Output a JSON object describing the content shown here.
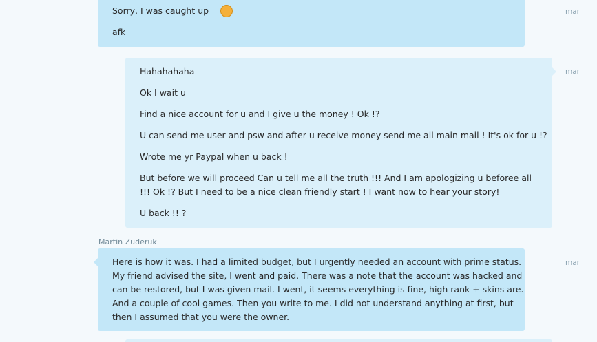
{
  "messages": [
    {
      "id": "msg-1",
      "direction": "incoming",
      "partial_line": "Sorry, I was caught up",
      "lines": [
        "afk"
      ],
      "time": "mar"
    },
    {
      "id": "msg-2",
      "direction": "outgoing",
      "lines": [
        "Hahahahaha",
        "Ok I wait u",
        "Find a nice account for u and I give u the money ! Ok !?",
        "U can send me user and psw and after u receive money send me all main mail ! It's ok for u !?",
        "Wrote me yr Paypal when u back !",
        "But before we will proceed Can u tell me all the truth !!! And I am apologizing u beforee all !!! Ok !? But I need to be a nice clean friendly start ! I want now to hear your story!",
        "U back !! ?"
      ],
      "time": "mar"
    },
    {
      "id": "msg-3",
      "direction": "incoming",
      "sender": "Martin Zuderuk",
      "lines": [
        "Here is how it was. I had a limited budget, but I urgently needed an account with prime status.",
        "My friend advised the site, I went and paid. There was a note that the account was hacked and",
        "can be restored, but I was given mail. I went, it seems everything is fine, high rank + skins are.",
        "And a couple of cool games. Then you write to me. I did not understand anything at first, but",
        "then I assumed that you were the owner."
      ],
      "time": "mar"
    }
  ],
  "colors": {
    "background": "#f4f9fc",
    "incoming_bubble": "#c3e7f8",
    "outgoing_bubble": "#dbf0fa",
    "sender_name": "#6f8896",
    "timestamp": "#8aa2b0"
  },
  "icons": {
    "emoji": "smiley-emoji-icon"
  }
}
